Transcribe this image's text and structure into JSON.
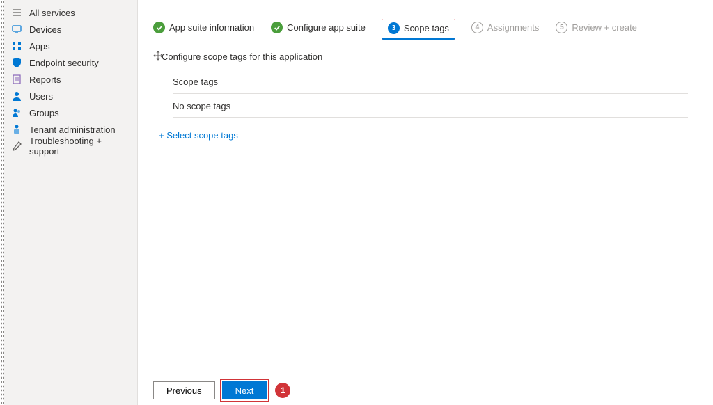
{
  "sidebar": {
    "items": [
      {
        "label": "All services",
        "icon": "list-icon"
      },
      {
        "label": "Devices",
        "icon": "monitor-icon"
      },
      {
        "label": "Apps",
        "icon": "grid-icon"
      },
      {
        "label": "Endpoint security",
        "icon": "shield-icon"
      },
      {
        "label": "Reports",
        "icon": "report-icon"
      },
      {
        "label": "Users",
        "icon": "person-icon"
      },
      {
        "label": "Groups",
        "icon": "group-icon"
      },
      {
        "label": "Tenant administration",
        "icon": "admin-icon"
      },
      {
        "label": "Troubleshooting + support",
        "icon": "wrench-icon"
      }
    ]
  },
  "wizard": {
    "steps": [
      {
        "num": "1",
        "label": "App suite information",
        "state": "done"
      },
      {
        "num": "2",
        "label": "Configure app suite",
        "state": "done"
      },
      {
        "num": "3",
        "label": "Scope tags",
        "state": "active"
      },
      {
        "num": "4",
        "label": "Assignments",
        "state": "disabled"
      },
      {
        "num": "5",
        "label": "Review + create",
        "state": "disabled"
      }
    ]
  },
  "content": {
    "subheader": "Configure scope tags for this application",
    "section_label": "Scope tags",
    "empty_text": "No scope tags",
    "select_link": "+ Select scope tags"
  },
  "footer": {
    "previous": "Previous",
    "next": "Next",
    "callout": "1"
  }
}
